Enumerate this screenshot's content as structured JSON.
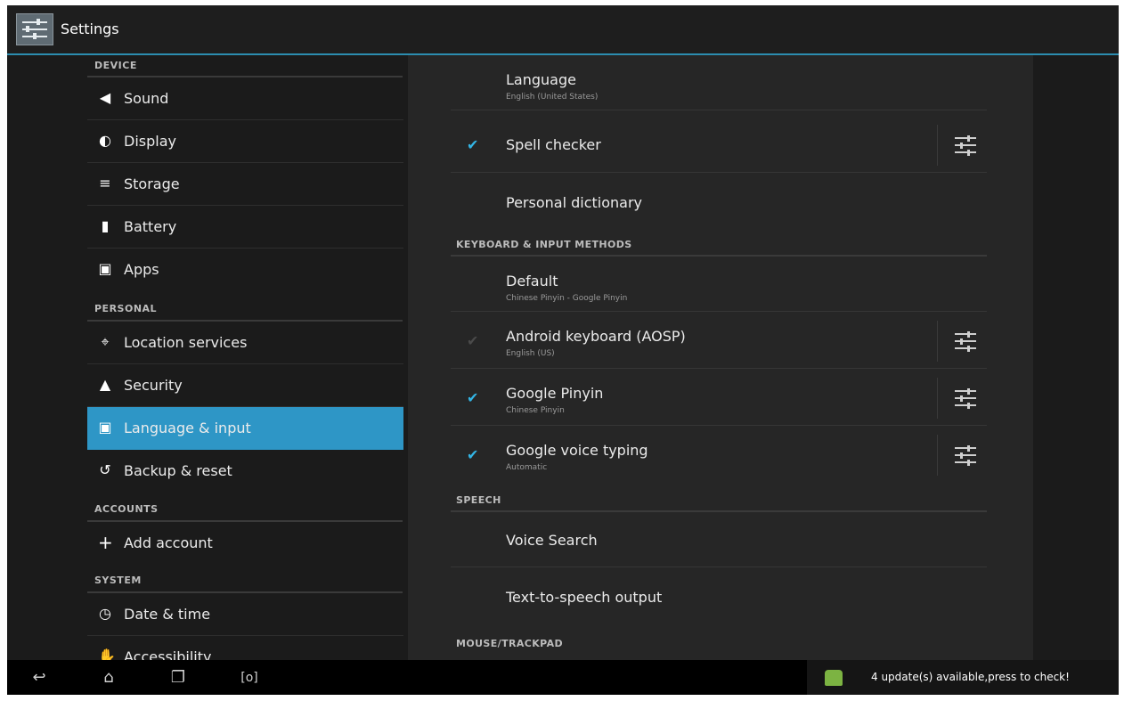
{
  "action_bar": {
    "title": "Settings"
  },
  "left_pane": {
    "categories": {
      "device": "DEVICE",
      "personal": "PERSONAL",
      "accounts": "ACCOUNTS",
      "system": "SYSTEM"
    },
    "items": {
      "sound": "Sound",
      "display": "Display",
      "storage": "Storage",
      "battery": "Battery",
      "apps": "Apps",
      "location": "Location services",
      "security": "Security",
      "language": "Language & input",
      "backup": "Backup & reset",
      "add_account": "Add account",
      "date_time": "Date & time",
      "accessibility": "Accessibility"
    },
    "selected": "Language & input"
  },
  "right_pane": {
    "language": {
      "title": "Language",
      "summary": "English (United States)"
    },
    "spell_checker": {
      "title": "Spell checker",
      "checked": true
    },
    "personal_dictionary": {
      "title": "Personal dictionary"
    },
    "keyboard_header": "KEYBOARD & INPUT METHODS",
    "default": {
      "title": "Default",
      "summary": "Chinese Pinyin - Google Pinyin"
    },
    "android_keyboard": {
      "title": "Android keyboard (AOSP)",
      "summary": "English (US)",
      "checked": true,
      "enabled": false
    },
    "google_pinyin": {
      "title": "Google Pinyin",
      "summary": "Chinese Pinyin",
      "checked": true
    },
    "google_voice": {
      "title": "Google voice typing",
      "summary": "Automatic",
      "checked": true
    },
    "speech_header": "SPEECH",
    "voice_search": {
      "title": "Voice Search"
    },
    "tts": {
      "title": "Text-to-speech output"
    },
    "mouse_header": "MOUSE/TRACKPAD"
  },
  "nav_bar": {
    "back": "back-icon",
    "home": "home-icon",
    "recents": "recents-icon",
    "screenshot": "[o]"
  },
  "notification": {
    "text": "4 update(s) available,press to check!"
  },
  "colors": {
    "accent": "#33b5e5",
    "selected": "#2e96c6",
    "background": "#1b1b1b"
  }
}
